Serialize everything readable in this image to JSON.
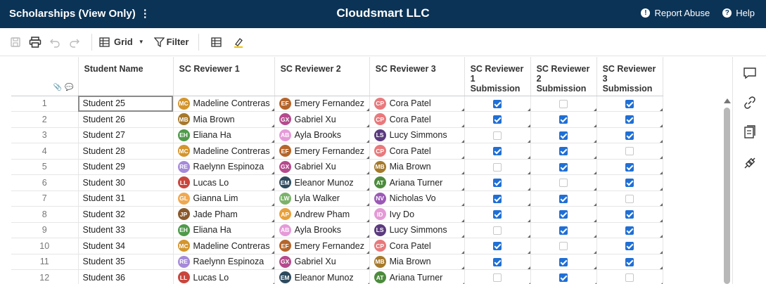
{
  "header": {
    "sheet_title": "Scholarships (View Only)",
    "kebab": "⋮",
    "org_name": "Cloudsmart LLC",
    "report_abuse": "Report Abuse",
    "help": "Help"
  },
  "toolbar": {
    "view_label": "Grid",
    "filter_label": "Filter"
  },
  "columns": {
    "student_name": "Student Name",
    "reviewer1": "SC Reviewer 1",
    "reviewer2": "SC Reviewer 2",
    "reviewer3": "SC Reviewer 3",
    "sub1": "SC Reviewer 1 Submission",
    "sub2": "SC Reviewer 2 Submission",
    "sub3": "SC Reviewer 3 Submission"
  },
  "rows": [
    {
      "num": "1",
      "student": "Student 25",
      "r1": {
        "ini": "MC",
        "name": "Madeline Contreras",
        "color": "#d4952c"
      },
      "r2": {
        "ini": "EF",
        "name": "Emery Fernandez",
        "color": "#b5652a"
      },
      "r3": {
        "ini": "CP",
        "name": "Cora Patel",
        "color": "#e8797c"
      },
      "s1": true,
      "s2": false,
      "s3": true
    },
    {
      "num": "2",
      "student": "Student 26",
      "r1": {
        "ini": "MB",
        "name": "Mia Brown",
        "color": "#a6792b"
      },
      "r2": {
        "ini": "GX",
        "name": "Gabriel Xu",
        "color": "#b54a8c"
      },
      "r3": {
        "ini": "CP",
        "name": "Cora Patel",
        "color": "#e8797c"
      },
      "s1": true,
      "s2": true,
      "s3": true
    },
    {
      "num": "3",
      "student": "Student 27",
      "r1": {
        "ini": "EH",
        "name": "Eliana Ha",
        "color": "#4f9a4a"
      },
      "r2": {
        "ini": "AB",
        "name": "Ayla Brooks",
        "color": "#e59ad8"
      },
      "r3": {
        "ini": "LS",
        "name": "Lucy Simmons",
        "color": "#5b3a7e"
      },
      "s1": false,
      "s2": true,
      "s3": true
    },
    {
      "num": "4",
      "student": "Student 28",
      "r1": {
        "ini": "MC",
        "name": "Madeline Contreras",
        "color": "#d4952c"
      },
      "r2": {
        "ini": "EF",
        "name": "Emery Fernandez",
        "color": "#b5652a"
      },
      "r3": {
        "ini": "CP",
        "name": "Cora Patel",
        "color": "#e8797c"
      },
      "s1": true,
      "s2": true,
      "s3": false
    },
    {
      "num": "5",
      "student": "Student 29",
      "r1": {
        "ini": "RE",
        "name": "Raelynn Espinoza",
        "color": "#a58ad9"
      },
      "r2": {
        "ini": "GX",
        "name": "Gabriel Xu",
        "color": "#b54a8c"
      },
      "r3": {
        "ini": "MB",
        "name": "Mia Brown",
        "color": "#a6792b"
      },
      "s1": false,
      "s2": true,
      "s3": true
    },
    {
      "num": "6",
      "student": "Student 30",
      "r1": {
        "ini": "LL",
        "name": "Lucas Lo",
        "color": "#c9463d"
      },
      "r2": {
        "ini": "EM",
        "name": "Eleanor Munoz",
        "color": "#2d4a5e"
      },
      "r3": {
        "ini": "AT",
        "name": "Ariana Turner",
        "color": "#4c8b3c"
      },
      "s1": true,
      "s2": false,
      "s3": true
    },
    {
      "num": "7",
      "student": "Student 31",
      "r1": {
        "ini": "GL",
        "name": "Gianna Lim",
        "color": "#f0a850"
      },
      "r2": {
        "ini": "LW",
        "name": "Lyla Walker",
        "color": "#7bb26a"
      },
      "r3": {
        "ini": "NV",
        "name": "Nicholas Vo",
        "color": "#9b59b6"
      },
      "s1": true,
      "s2": true,
      "s3": false
    },
    {
      "num": "8",
      "student": "Student 32",
      "r1": {
        "ini": "JP",
        "name": "Jade Pham",
        "color": "#8a5a2b"
      },
      "r2": {
        "ini": "AP",
        "name": "Andrew Pham",
        "color": "#e8a03a"
      },
      "r3": {
        "ini": "ID",
        "name": "Ivy Do",
        "color": "#e49ad6"
      },
      "s1": true,
      "s2": true,
      "s3": true
    },
    {
      "num": "9",
      "student": "Student 33",
      "r1": {
        "ini": "EH",
        "name": "Eliana Ha",
        "color": "#4f9a4a"
      },
      "r2": {
        "ini": "AB",
        "name": "Ayla Brooks",
        "color": "#e59ad8"
      },
      "r3": {
        "ini": "LS",
        "name": "Lucy Simmons",
        "color": "#5b3a7e"
      },
      "s1": false,
      "s2": true,
      "s3": true
    },
    {
      "num": "10",
      "student": "Student 34",
      "r1": {
        "ini": "MC",
        "name": "Madeline Contreras",
        "color": "#d4952c"
      },
      "r2": {
        "ini": "EF",
        "name": "Emery Fernandez",
        "color": "#b5652a"
      },
      "r3": {
        "ini": "CP",
        "name": "Cora Patel",
        "color": "#e8797c"
      },
      "s1": true,
      "s2": false,
      "s3": true
    },
    {
      "num": "11",
      "student": "Student 35",
      "r1": {
        "ini": "RE",
        "name": "Raelynn Espinoza",
        "color": "#a58ad9"
      },
      "r2": {
        "ini": "GX",
        "name": "Gabriel Xu",
        "color": "#b54a8c"
      },
      "r3": {
        "ini": "MB",
        "name": "Mia Brown",
        "color": "#a6792b"
      },
      "s1": true,
      "s2": true,
      "s3": true
    },
    {
      "num": "12",
      "student": "Student 36",
      "r1": {
        "ini": "LL",
        "name": "Lucas Lo",
        "color": "#c9463d"
      },
      "r2": {
        "ini": "EM",
        "name": "Eleanor Munoz",
        "color": "#2d4a5e"
      },
      "r3": {
        "ini": "AT",
        "name": "Ariana Turner",
        "color": "#4c8b3c"
      },
      "s1": false,
      "s2": true,
      "s3": false
    }
  ],
  "colors": {
    "header_bg": "#0b3356",
    "checkbox_on": "#1f6fd6"
  }
}
